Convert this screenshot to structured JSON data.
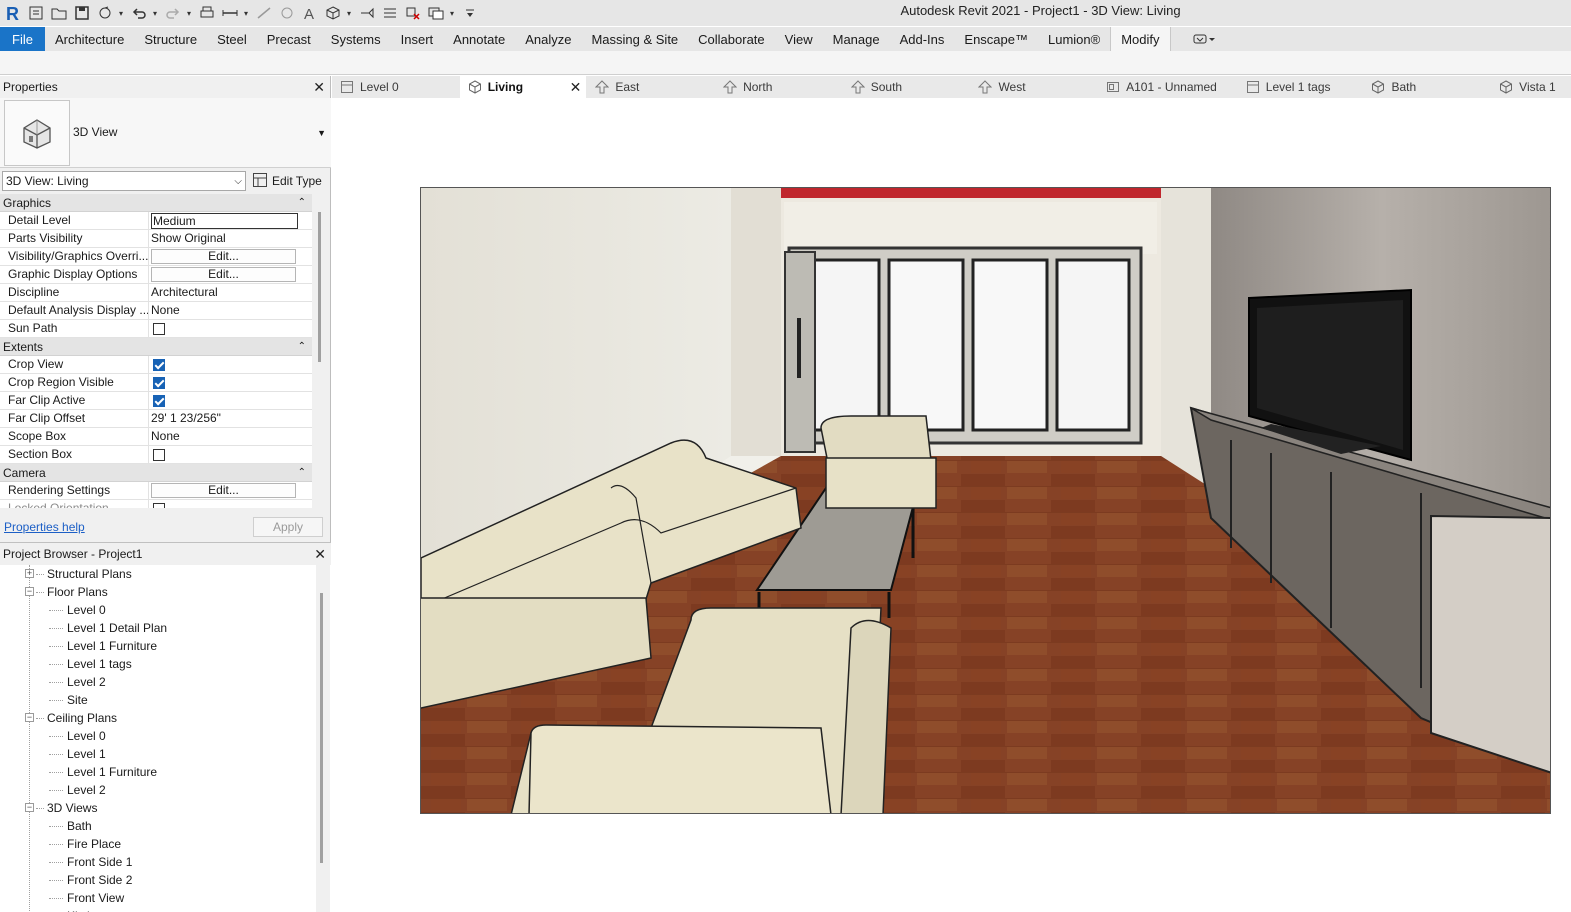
{
  "app": {
    "title": "Autodesk Revit 2021 - Project1 - 3D View: Living"
  },
  "qat": {
    "icons": [
      "revit-logo-icon",
      "home-icon",
      "open-icon",
      "save-icon",
      "sync-icon",
      "undo-icon",
      "redo-icon",
      "print-icon",
      "measure-icon",
      "align-dimension-icon",
      "tag-icon",
      "text-icon",
      "3d-view-icon",
      "section-icon",
      "thin-lines-icon",
      "close-hidden-icon",
      "switch-windows-icon",
      "customize-icon"
    ]
  },
  "ribbon": {
    "tabs": [
      {
        "label": "File"
      },
      {
        "label": "Architecture"
      },
      {
        "label": "Structure"
      },
      {
        "label": "Steel"
      },
      {
        "label": "Precast"
      },
      {
        "label": "Systems"
      },
      {
        "label": "Insert"
      },
      {
        "label": "Annotate"
      },
      {
        "label": "Analyze"
      },
      {
        "label": "Massing & Site"
      },
      {
        "label": "Collaborate"
      },
      {
        "label": "View"
      },
      {
        "label": "Manage"
      },
      {
        "label": "Add-Ins"
      },
      {
        "label": "Enscape™"
      },
      {
        "label": "Lumion®"
      },
      {
        "label": "Modify"
      }
    ],
    "active_tab": "Modify"
  },
  "properties": {
    "title": "Properties",
    "type_name": "3D View",
    "instance_selector": "3D View: Living",
    "edit_type_label": "Edit Type",
    "groups": [
      {
        "name": "Graphics",
        "rows": [
          {
            "label": "Detail Level",
            "kind": "text",
            "value": "Medium",
            "editing": true
          },
          {
            "label": "Parts Visibility",
            "kind": "text",
            "value": "Show Original"
          },
          {
            "label": "Visibility/Graphics Overri...",
            "kind": "button",
            "value": "Edit..."
          },
          {
            "label": "Graphic Display Options",
            "kind": "button",
            "value": "Edit..."
          },
          {
            "label": "Discipline",
            "kind": "text",
            "value": "Architectural"
          },
          {
            "label": "Default Analysis Display ...",
            "kind": "text",
            "value": "None"
          },
          {
            "label": "Sun Path",
            "kind": "check",
            "checked": false
          }
        ]
      },
      {
        "name": "Extents",
        "rows": [
          {
            "label": "Crop View",
            "kind": "check",
            "checked": true
          },
          {
            "label": "Crop Region Visible",
            "kind": "check",
            "checked": true
          },
          {
            "label": "Far Clip Active",
            "kind": "check",
            "checked": true
          },
          {
            "label": "Far Clip Offset",
            "kind": "text",
            "value": "29'  1 23/256\""
          },
          {
            "label": "Scope Box",
            "kind": "text",
            "value": "None"
          },
          {
            "label": "Section Box",
            "kind": "check",
            "checked": false
          }
        ]
      },
      {
        "name": "Camera",
        "rows": [
          {
            "label": "Rendering Settings",
            "kind": "button",
            "value": "Edit..."
          },
          {
            "label": "Locked Orientation",
            "kind": "check",
            "checked": false,
            "dim": true
          }
        ]
      }
    ],
    "help_link": "Properties help",
    "apply_label": "Apply"
  },
  "project_browser": {
    "title": "Project Browser - Project1",
    "nodes": [
      {
        "label": "Structural Plans",
        "level": 1,
        "expander": "+"
      },
      {
        "label": "Floor Plans",
        "level": 1,
        "expander": "-"
      },
      {
        "label": "Level 0",
        "level": 2
      },
      {
        "label": "Level 1 Detail Plan",
        "level": 2
      },
      {
        "label": "Level 1 Furniture",
        "level": 2
      },
      {
        "label": "Level 1 tags",
        "level": 2
      },
      {
        "label": "Level 2",
        "level": 2
      },
      {
        "label": "Site",
        "level": 2
      },
      {
        "label": "Ceiling Plans",
        "level": 1,
        "expander": "-"
      },
      {
        "label": "Level 0",
        "level": 2
      },
      {
        "label": "Level 1",
        "level": 2
      },
      {
        "label": "Level 1 Furniture",
        "level": 2
      },
      {
        "label": "Level 2",
        "level": 2
      },
      {
        "label": "3D Views",
        "level": 1,
        "expander": "-"
      },
      {
        "label": "Bath",
        "level": 2
      },
      {
        "label": "Fire Place",
        "level": 2
      },
      {
        "label": "Front Side 1",
        "level": 2
      },
      {
        "label": "Front Side 2",
        "level": 2
      },
      {
        "label": "Front View",
        "level": 2
      },
      {
        "label": "Kitchen",
        "level": 2
      }
    ]
  },
  "view_tabs": [
    {
      "label": "Level 0",
      "icon": "floor-plan-icon",
      "width": 128
    },
    {
      "label": "Living",
      "icon": "3d-view-icon",
      "width": 128,
      "active": true
    },
    {
      "label": "East",
      "icon": "elevation-icon",
      "width": 128
    },
    {
      "label": "North",
      "icon": "elevation-icon",
      "width": 128
    },
    {
      "label": "South",
      "icon": "elevation-icon",
      "width": 128
    },
    {
      "label": "West",
      "icon": "elevation-icon",
      "width": 128
    },
    {
      "label": "A101 - Unnamed",
      "icon": "sheet-icon",
      "width": 140
    },
    {
      "label": "Level 1 tags",
      "icon": "floor-plan-icon",
      "width": 126
    },
    {
      "label": "Bath",
      "icon": "3d-view-icon",
      "width": 128
    },
    {
      "label": "Vista 1",
      "icon": "3d-view-icon",
      "width": 80
    }
  ],
  "colors": {
    "file_tab": "#1a74c8",
    "checkbox": "#1762b5",
    "link": "#1c5fc6",
    "floor": "#8a3c22",
    "sofa": "#e8e2c8",
    "wall_left": "#e9e6dc",
    "wall_right": "#b0a9a2",
    "header_red": "#c0272d"
  }
}
